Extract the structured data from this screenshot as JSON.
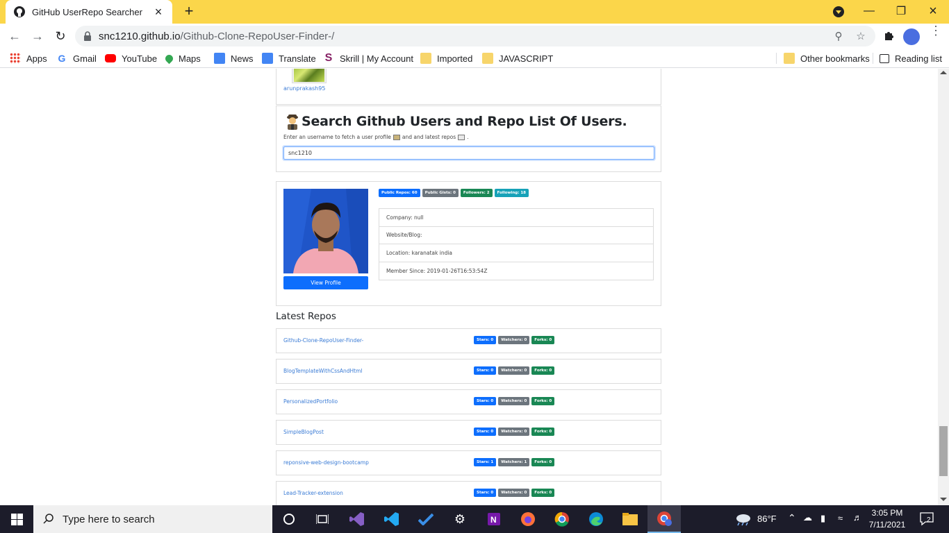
{
  "browser": {
    "tab_title": "GitHub UserRepo Searcher",
    "url_host": "snc1210.github.io",
    "url_path": "/Github-Clone-RepoUser-Finder-/",
    "bookmarks": [
      "Apps",
      "Gmail",
      "YouTube",
      "Maps",
      "News",
      "Translate",
      "Skrill | My Account",
      "Imported",
      "JAVASCRIPT"
    ],
    "other_bookmarks": "Other bookmarks",
    "reading_list": "Reading list"
  },
  "page": {
    "prev_user_login": "arunprakash95",
    "search": {
      "title": "Search Github Users and Repo List Of Users.",
      "desc_part1": "Enter an username to fetch a user profile",
      "desc_part2": "and and latest repos",
      "desc_end": ".",
      "input_value": "snc1210"
    },
    "profile": {
      "badges": [
        "Public Repos: 60",
        "Public Gists: 0",
        "Followers: 2",
        "Following: 18"
      ],
      "company": "Company: null",
      "website": "Website/Blog:",
      "location": "Location: karanatak india",
      "member_since": "Member Since: 2019-01-26T16:53:54Z",
      "view_profile": "View Profile"
    },
    "repos_heading": "Latest Repos",
    "repos": [
      {
        "name": "Github-Clone-RepoUser-Finder-",
        "stars": "Stars: 0",
        "watchers": "Watchers: 0",
        "forks": "Forks: 0"
      },
      {
        "name": "BlogTemplateWithCssAndHtml",
        "stars": "Stars: 0",
        "watchers": "Watchers: 0",
        "forks": "Forks: 0"
      },
      {
        "name": "PersonalizedPortfolio",
        "stars": "Stars: 0",
        "watchers": "Watchers: 0",
        "forks": "Forks: 0"
      },
      {
        "name": "SimpleBlogPost",
        "stars": "Stars: 0",
        "watchers": "Watchers: 0",
        "forks": "Forks: 0"
      },
      {
        "name": "reponsive-web-design-bootcamp",
        "stars": "Stars: 1",
        "watchers": "Watchers: 1",
        "forks": "Forks: 0"
      },
      {
        "name": "Lead-Tracker-extension",
        "stars": "Stars: 0",
        "watchers": "Watchers: 0",
        "forks": "Forks: 0"
      }
    ]
  },
  "taskbar": {
    "search_placeholder": "Type here to search",
    "temperature": "86°F",
    "time": "3:05 PM",
    "date": "7/11/2021",
    "notifications": "2"
  },
  "colors": {
    "chrome_frame": "#fbd64a",
    "badge_primary": "#0d6efd",
    "badge_secondary": "#6c757d",
    "badge_success": "#198754",
    "badge_info": "#17a2b8",
    "link": "#3a7bd5"
  }
}
